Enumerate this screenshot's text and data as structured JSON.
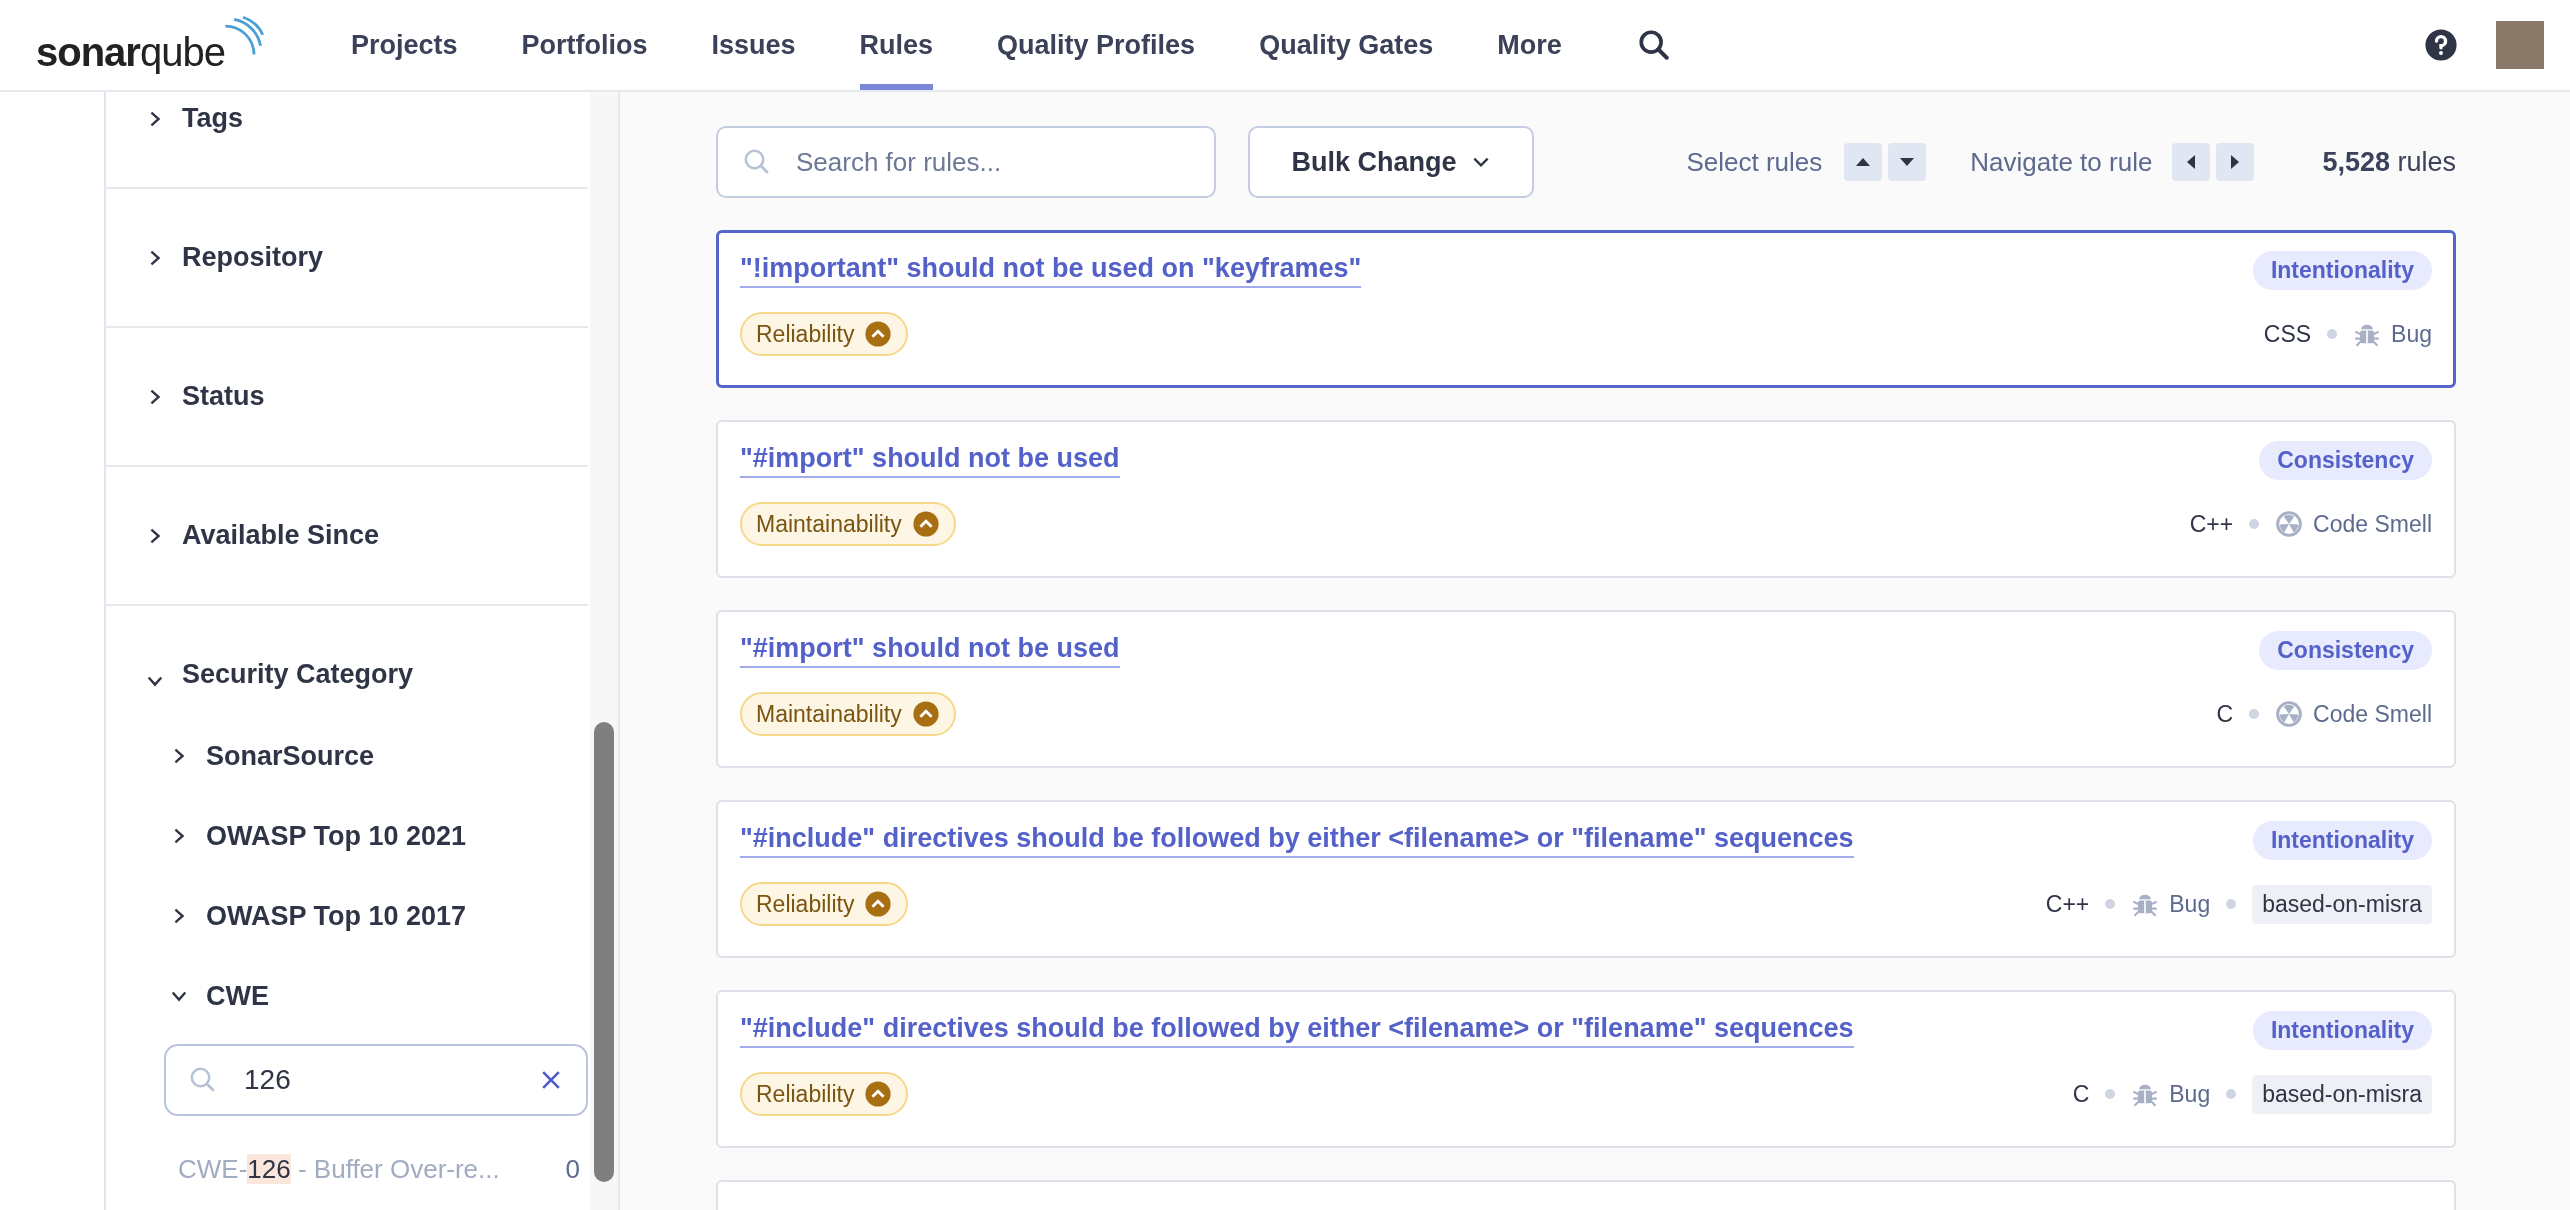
{
  "header": {
    "logo": {
      "first": "sonar",
      "second": "qube"
    },
    "nav": [
      {
        "label": "Projects",
        "selected": false
      },
      {
        "label": "Portfolios",
        "selected": false
      },
      {
        "label": "Issues",
        "selected": false
      },
      {
        "label": "Rules",
        "selected": true
      },
      {
        "label": "Quality Profiles",
        "selected": false
      },
      {
        "label": "Quality Gates",
        "selected": false
      },
      {
        "label": "More",
        "selected": false
      }
    ]
  },
  "sidebar": {
    "facets": [
      {
        "label": "Tags",
        "expanded": false
      },
      {
        "label": "Repository",
        "expanded": false
      },
      {
        "label": "Status",
        "expanded": false
      },
      {
        "label": "Available Since",
        "expanded": false
      },
      {
        "label": "Security Category",
        "expanded": true,
        "children": [
          {
            "label": "SonarSource",
            "expanded": false
          },
          {
            "label": "OWASP Top 10 2021",
            "expanded": false
          },
          {
            "label": "OWASP Top 10 2017",
            "expanded": false
          },
          {
            "label": "CWE",
            "expanded": true,
            "search": {
              "value": "126"
            },
            "results": [
              {
                "prefix": "CWE-",
                "match": "126",
                "suffix": " - Buffer Over-re...",
                "count": "0"
              }
            ]
          }
        ]
      }
    ]
  },
  "toolbar": {
    "search": {
      "placeholder": "Search for rules..."
    },
    "bulk_change": "Bulk Change",
    "select_rules": "Select rules",
    "navigate": "Navigate to rule",
    "count": "5,528",
    "count_unit": "rules"
  },
  "rules": [
    {
      "title": "\"!important\" should not be used on \"keyframes\"",
      "selected": true,
      "attribute": "Intentionality",
      "quality": "Reliability",
      "language": "CSS",
      "type": {
        "kind": "bug",
        "label": "Bug"
      }
    },
    {
      "title": "\"#import\" should not be used",
      "selected": false,
      "attribute": "Consistency",
      "quality": "Maintainability",
      "language": "C++",
      "type": {
        "kind": "code_smell",
        "label": "Code Smell"
      }
    },
    {
      "title": "\"#import\" should not be used",
      "selected": false,
      "attribute": "Consistency",
      "quality": "Maintainability",
      "language": "C",
      "type": {
        "kind": "code_smell",
        "label": "Code Smell"
      }
    },
    {
      "title": "\"#include\" directives should be followed by either <filename> or \"filename\" sequences",
      "selected": false,
      "attribute": "Intentionality",
      "quality": "Reliability",
      "language": "C++",
      "type": {
        "kind": "bug",
        "label": "Bug"
      },
      "tag": "based-on-misra"
    },
    {
      "title": "\"#include\" directives should be followed by either <filename> or \"filename\" sequences",
      "selected": false,
      "attribute": "Intentionality",
      "quality": "Reliability",
      "language": "C",
      "type": {
        "kind": "bug",
        "label": "Bug"
      },
      "tag": "based-on-misra"
    }
  ]
}
